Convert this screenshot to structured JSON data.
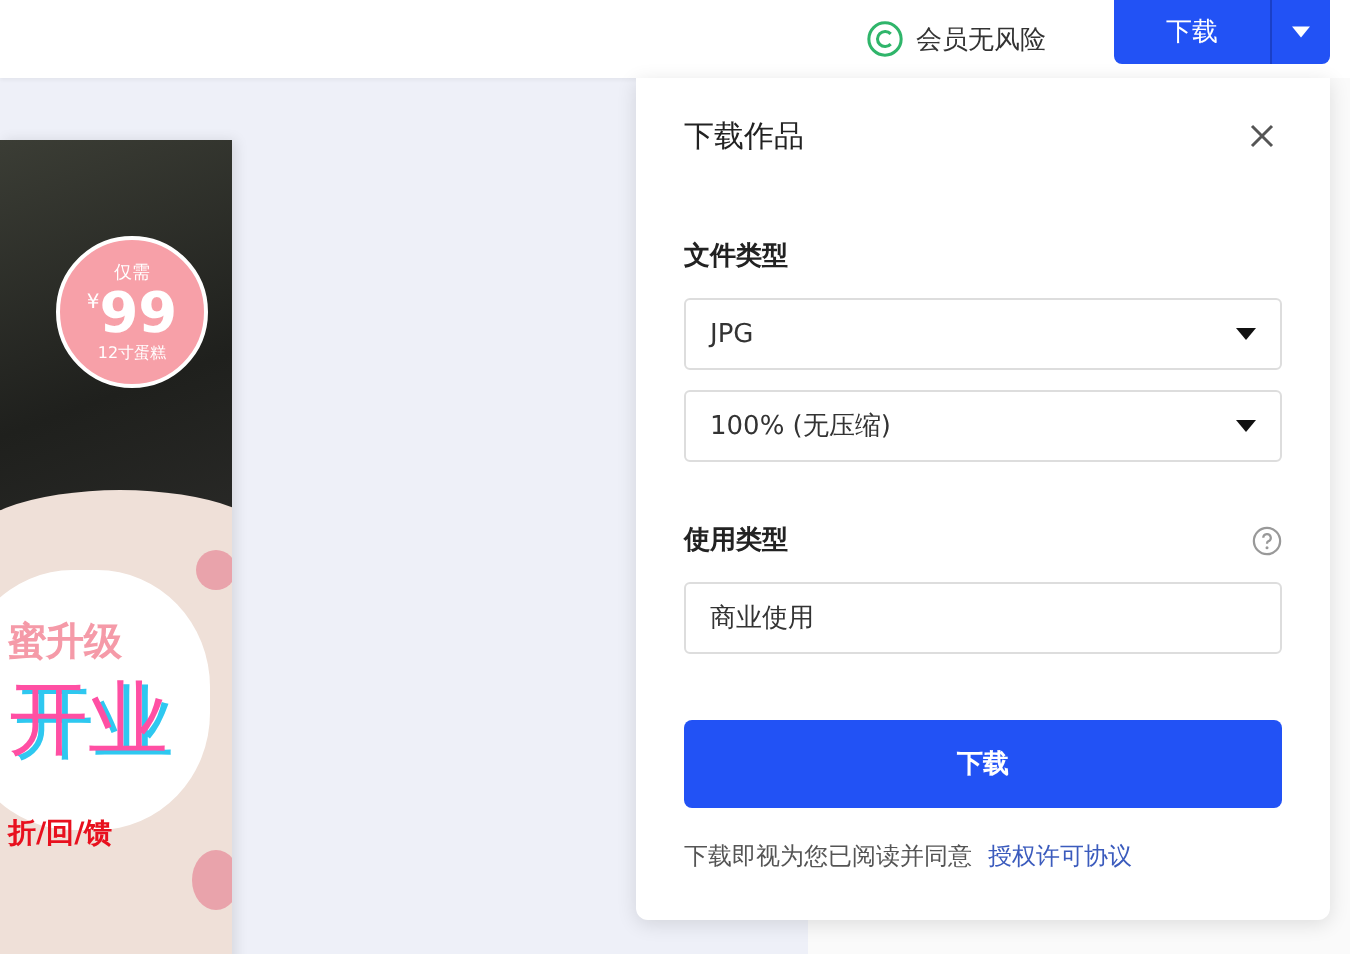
{
  "header": {
    "badge": "会员无风险",
    "download_button": "下载"
  },
  "poster": {
    "price_badge": {
      "top": "仅需",
      "currency": "¥",
      "price": "99",
      "bottom": "12寸蛋糕"
    },
    "headline": "蜜升级",
    "title": "开业",
    "tagline": "折/回/馈"
  },
  "dialog": {
    "title": "下载作品",
    "file_type_label": "文件类型",
    "format_select": "JPG",
    "quality_select": "100% (无压缩)",
    "usage_label": "使用类型",
    "usage_field": "商业使用",
    "download_button": "下载",
    "agreement_text": "下载即视为您已阅读并同意",
    "agreement_link": "授权许可协议"
  }
}
